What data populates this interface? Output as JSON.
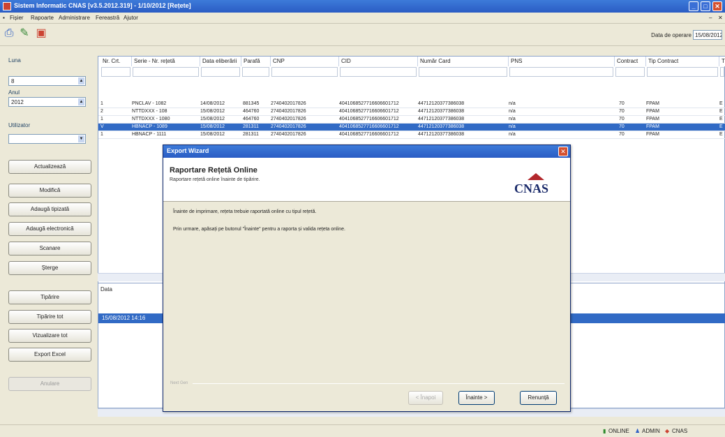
{
  "window": {
    "title": "Sistem Informatic CNAS [v3.5.2012.319] - 1/10/2012 [Rețete]"
  },
  "menu": [
    "Fișier",
    "Rapoarte",
    "Administrare",
    "Fereastră",
    "Ajutor"
  ],
  "toolbar": {
    "date_label": "Data de operare",
    "date_value": "15/08/2012"
  },
  "filters": {
    "luna_label": "Luna",
    "luna_value": "8",
    "anul_label": "Anul",
    "anul_value": "2012",
    "utilizator_label": "Utilizator",
    "utilizator_value": ""
  },
  "actions": [
    "Actualizează",
    "Modifică",
    "Adaugă tipizată",
    "Adaugă electronică",
    "Scanare",
    "Șterge",
    "Tipărire",
    "Tipărire tot",
    "Vizualizare tot",
    "Export Excel",
    "Anulare"
  ],
  "grid": {
    "columns": [
      "Nr. Crt.",
      "Serie - Nr. rețetă",
      "Data eliberării",
      "Parafă",
      "CNP",
      "CID",
      "Număr Card",
      "PNS",
      "Contract",
      "Tip Contract",
      "T"
    ],
    "rows": [
      [
        "1",
        "PNCLAV - 1082",
        "14/08/2012",
        "881345",
        "2740402017826",
        "4041068527716606601712",
        "44712120377386038",
        "n/a",
        "70",
        "FPAM",
        "E"
      ],
      [
        "2",
        "NTTDXXX - 108",
        "15/08/2012",
        "464760",
        "2740402017826",
        "4041068527716606601712",
        "44712120377386038",
        "n/a",
        "70",
        "FPAM",
        "E"
      ],
      [
        "1",
        "NTTDXXX - 1080",
        "15/08/2012",
        "464760",
        "2740402017826",
        "4041068527716606601712",
        "44712120377386038",
        "n/a",
        "70",
        "FPAM",
        "E"
      ],
      [
        "V",
        "HBNACP - 1089",
        "15/08/2012",
        "281311",
        "2740402017826",
        "4041068527716606601712",
        "44712120377386038",
        "n/a",
        "70",
        "FPAM",
        "E"
      ],
      [
        "1",
        "HBNACP - 1111",
        "15/08/2012",
        "281311",
        "2740402017826",
        "4041068527716606601712",
        "44712120377386038",
        "n/a",
        "70",
        "FPAM",
        "E"
      ]
    ],
    "selected_index": 3
  },
  "lower": {
    "header": "Data",
    "row": "15/08/2012 14:16"
  },
  "status": {
    "online": "ONLINE",
    "user": "ADMIN",
    "org": "CNAS"
  },
  "wizard": {
    "title": "Export Wizard",
    "heading": "Raportare Rețetă Online",
    "subheading": "Raportare rețetă online înainte de tipărire.",
    "logo_text": "CNAS",
    "paragraph1": "Înainte de imprimare, rețeta trebuie raportată online cu tipul rețetă.",
    "paragraph2": "Prin urmare, apăsați pe butonul \"Înainte\" pentru a raporta și valida rețeta online.",
    "separator_label": "Next Gen",
    "back": "< Înapoi",
    "next": "Înainte >",
    "cancel": "Renunță"
  }
}
